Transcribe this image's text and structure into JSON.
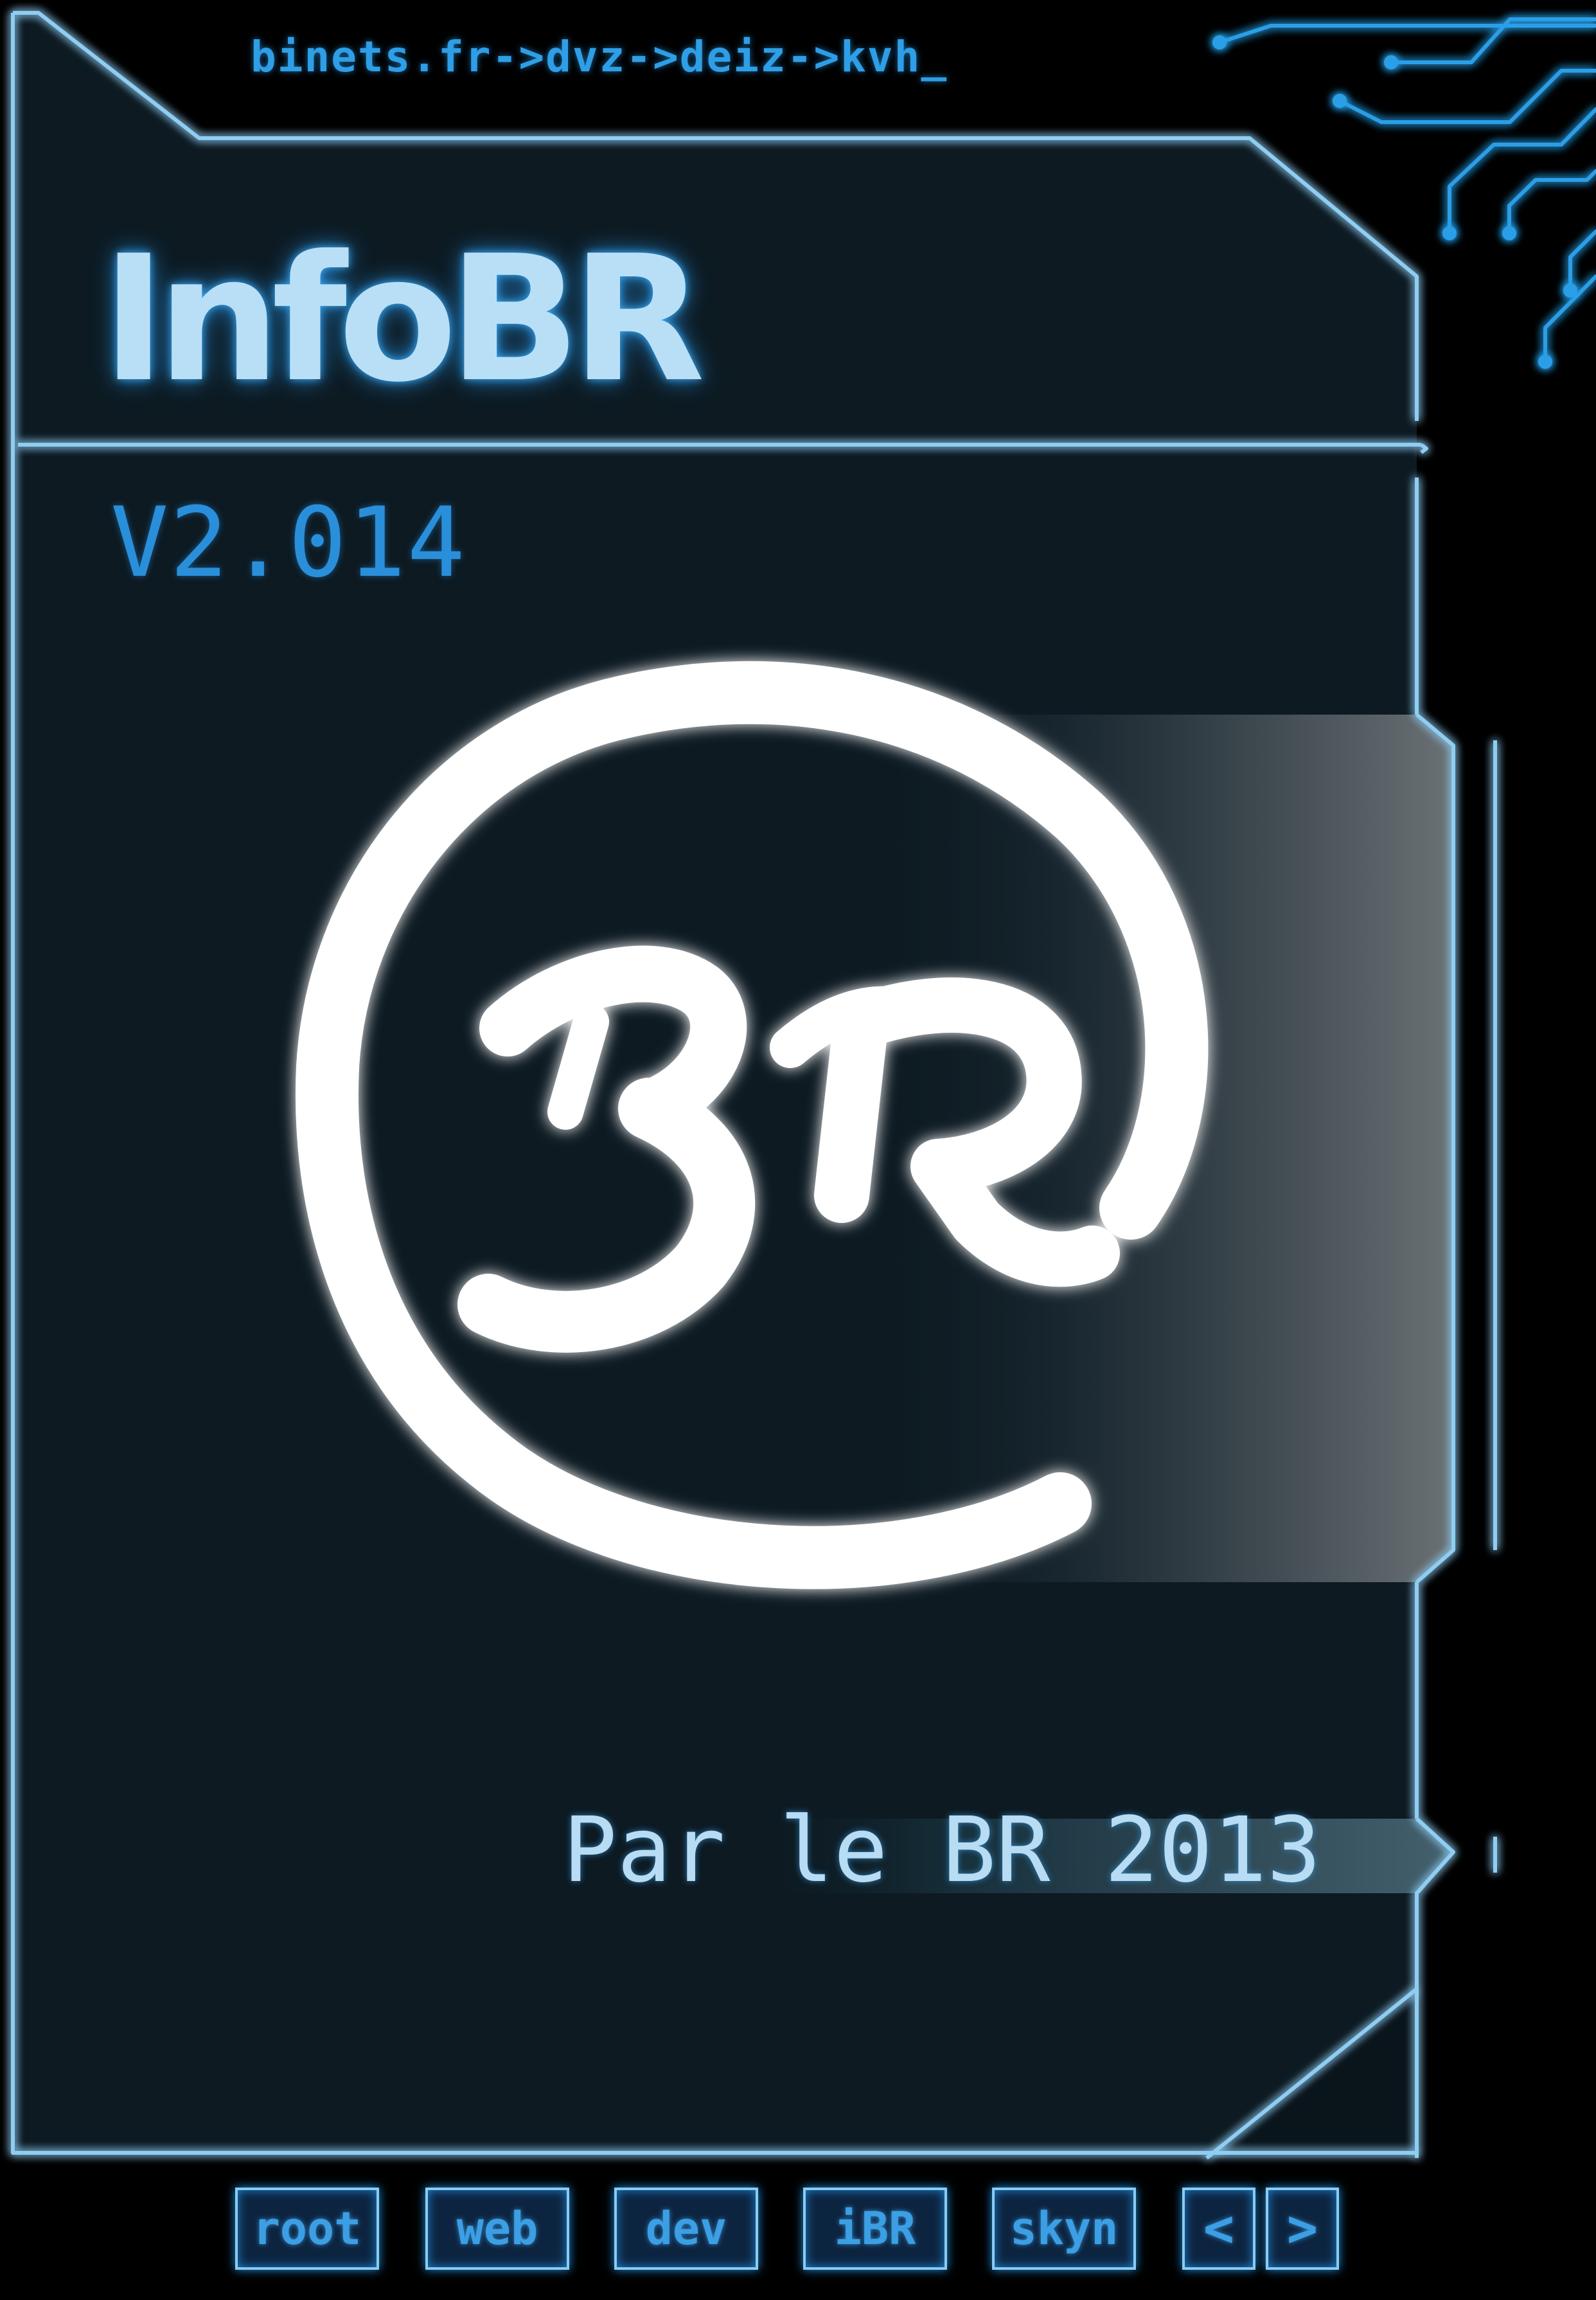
{
  "breadcrumb": "binets.fr->dvz->deiz->kvh_",
  "title": "InfoBR",
  "version": "V2.014",
  "tagline": "Par le BR 2013",
  "logo": {
    "name": "BR at-sign logo",
    "text": "BR"
  },
  "nav": {
    "root": "root",
    "web": "web",
    "dev": "dev",
    "ibr": "iBR",
    "skyn": "skyn",
    "prev": "<",
    "next": ">"
  },
  "colors": {
    "background": "#000000",
    "panel": "#0d1a22",
    "frame": "#8fcdf3",
    "accent": "#2a8fda",
    "glow": "#1f8fe0",
    "title": "#b9dff6",
    "logo": "#ffffff"
  },
  "icons": [
    "circuit-traces"
  ]
}
